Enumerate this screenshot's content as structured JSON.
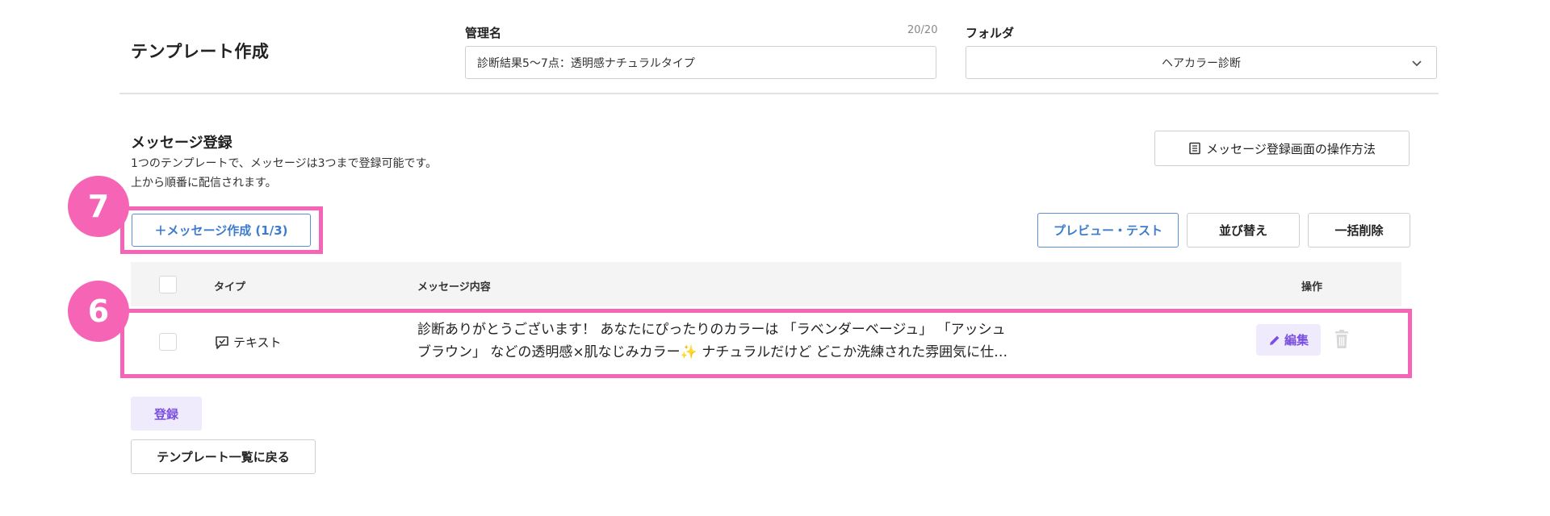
{
  "header": {
    "title": "テンプレート作成",
    "name_label": "管理名",
    "name_counter": "20/20",
    "name_value": "診断結果5〜7点：透明感ナチュラルタイプ",
    "folder_label": "フォルダ",
    "folder_value": "ヘアカラー診断"
  },
  "messages": {
    "title": "メッセージ登録",
    "desc_line1": "1つのテンプレートで、メッセージは3つまで登録可能です。",
    "desc_line2": "上から順番に配信されます。",
    "howto_label": "メッセージ登録画面の操作方法",
    "create_label": "＋メッセージ作成 (1/3)",
    "preview_label": "プレビュー・テスト",
    "sort_label": "並び替え",
    "bulk_delete_label": "一括削除"
  },
  "callouts": {
    "c7": "7",
    "c6": "6"
  },
  "table": {
    "columns": {
      "type": "タイプ",
      "content": "メッセージ内容",
      "action": "操作"
    },
    "rows": [
      {
        "type": "テキスト",
        "content_line1": "診断ありがとうございます！ あなたにぴったりのカラーは 「ラベンダーベージュ」 「アッシュ",
        "content_line2_a": "ブラウン」 などの透明感×肌なじみカラー",
        "content_sparkle": "✨",
        "content_line2_b": " ナチュラルだけど どこか洗練された雰囲気に仕…",
        "edit_label": "編集"
      }
    ]
  },
  "footer": {
    "register_label": "登録",
    "back_label": "テンプレート一覧に戻る"
  },
  "colors": {
    "accent_pink": "#f564b5",
    "accent_purple": "#7b4fe0",
    "accent_blue": "#3d7ccc"
  },
  "icons": {
    "select_arrow": "chevron-down-icon",
    "howto": "book-icon",
    "type": "chat-check-icon",
    "edit": "pencil-icon",
    "delete": "trash-icon"
  }
}
